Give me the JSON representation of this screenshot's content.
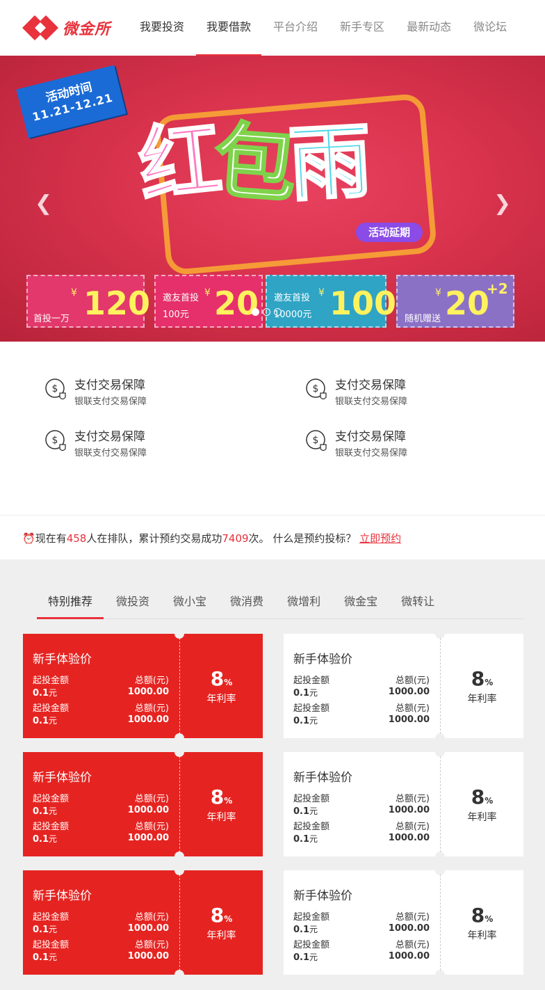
{
  "header": {
    "logo_text": "微金所",
    "nav": [
      "我要投资",
      "我要借款",
      "平台介绍",
      "新手专区",
      "最新动态",
      "微论坛"
    ]
  },
  "banner": {
    "badge_title": "活动时间",
    "badge_date": "11.21-12.21",
    "title_chars": [
      "红",
      "包",
      "雨"
    ],
    "delay_label": "活动延期",
    "coupons": [
      {
        "label": "首投一万",
        "yen": "¥",
        "amount": "120"
      },
      {
        "label": "邀友首投",
        "sub": "100元",
        "yen": "¥",
        "amount": "20"
      },
      {
        "label": "邀友首投",
        "sub": "10000元",
        "yen": "¥",
        "amount": "100"
      },
      {
        "label": "随机赠送",
        "yen": "¥",
        "amount": "20",
        "plus": "+2"
      }
    ],
    "prev_icon": "chevron-left-icon",
    "next_icon": "chevron-right-icon"
  },
  "features": [
    {
      "title": "支付交易保障",
      "sub": "银联支付交易保障",
      "icon": "dollar-shield-icon"
    },
    {
      "title": "支付交易保障",
      "sub": "银联支付交易保障",
      "icon": "dollar-shield-icon"
    },
    {
      "title": "支付交易保障",
      "sub": "银联支付交易保障",
      "icon": "dollar-shield-icon"
    },
    {
      "title": "支付交易保障",
      "sub": "银联支付交易保障",
      "icon": "dollar-shield-icon"
    }
  ],
  "notice": {
    "icon": "alarm-clock-icon",
    "p1": "现在有",
    "queue_count": "458",
    "p2": "人在排队，累计预约交易成功",
    "success_count": "7409",
    "p3": "次。 什么是预约投标？",
    "link": "立即预约"
  },
  "tabs": [
    "特别推荐",
    "微投资",
    "微小宝",
    "微消费",
    "微增利",
    "微金宝",
    "微转让"
  ],
  "products": [
    {
      "title": "新手体验价",
      "min_label": "起投金额",
      "min_value": "0.1",
      "min_unit": "元",
      "total_label": "总额(元)",
      "total_value": "1000.00",
      "rate": "8",
      "rate_unit": "%",
      "rate_label": "年利率"
    },
    {
      "title": "新手体验价",
      "min_label": "起投金额",
      "min_value": "0.1",
      "min_unit": "元",
      "total_label": "总额(元)",
      "total_value": "1000.00",
      "rate": "8",
      "rate_unit": "%",
      "rate_label": "年利率"
    },
    {
      "title": "新手体验价",
      "min_label": "起投金额",
      "min_value": "0.1",
      "min_unit": "元",
      "total_label": "总额(元)",
      "total_value": "1000.00",
      "rate": "8",
      "rate_unit": "%",
      "rate_label": "年利率"
    },
    {
      "title": "新手体验价",
      "min_label": "起投金额",
      "min_value": "0.1",
      "min_unit": "元",
      "total_label": "总额(元)",
      "total_value": "1000.00",
      "rate": "8",
      "rate_unit": "%",
      "rate_label": "年利率"
    },
    {
      "title": "新手体验价",
      "min_label": "起投金额",
      "min_value": "0.1",
      "min_unit": "元",
      "total_label": "总额(元)",
      "total_value": "1000.00",
      "rate": "8",
      "rate_unit": "%",
      "rate_label": "年利率"
    },
    {
      "title": "新手体验价",
      "min_label": "起投金额",
      "min_value": "0.1",
      "min_unit": "元",
      "total_label": "总额(元)",
      "total_value": "1000.00",
      "rate": "8",
      "rate_unit": "%",
      "rate_label": "年利率"
    }
  ],
  "colors": {
    "brand": "#e8323c",
    "card_red": "#e52421"
  }
}
